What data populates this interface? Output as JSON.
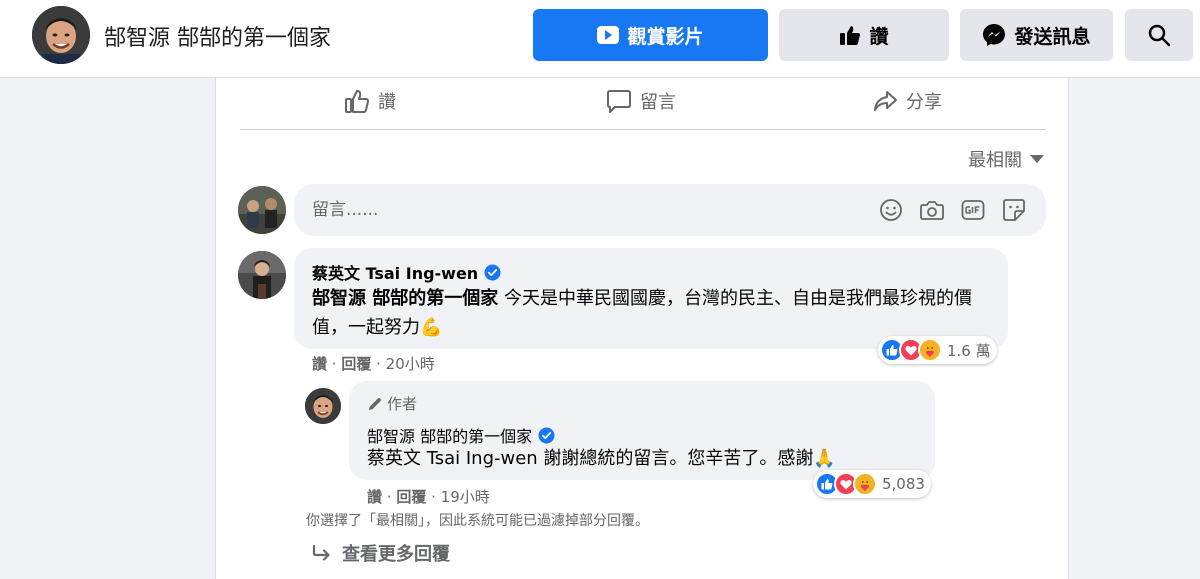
{
  "header": {
    "page_name": "郜智源 郜郜的第一個家",
    "watch_label": "觀賞影片",
    "like_label": "讚",
    "message_label": "發送訊息"
  },
  "post_actions": {
    "like": "讚",
    "comment": "留言",
    "share": "分享"
  },
  "sort_label": "最相關",
  "comment_input": {
    "placeholder": "留言......"
  },
  "comments": [
    {
      "author": "蔡英文 Tsai Ing-wen",
      "verified": true,
      "mention": "郜智源 郜郜的第一個家",
      "text": " 今天是中華民國國慶，台灣的民主、自由是我們最珍視的價值，一起努力💪",
      "like_action": "讚",
      "reply_action": "回覆",
      "time": "20小時",
      "reaction_count": "1.6 萬",
      "reactions": [
        "like",
        "love",
        "care"
      ]
    }
  ],
  "reply": {
    "author_tag": "作者",
    "author": "郜智源 郜郜的第一個家",
    "verified": true,
    "text": "蔡英文 Tsai Ing-wen 謝謝總統的留言。您辛苦了。感謝🙏",
    "like_action": "讚",
    "reply_action": "回覆",
    "time": "19小時",
    "reaction_count": "5,083",
    "reactions": [
      "like",
      "love",
      "care"
    ]
  },
  "filter_note": "你選擇了「最相關」，因此系統可能已過濾掉部分回覆。",
  "more_replies_label": "查看更多回覆",
  "colors": {
    "brand_blue": "#1877f2",
    "secondary_text": "#65676b",
    "love_red": "#f33e58",
    "care_yellow": "#f7b125"
  }
}
